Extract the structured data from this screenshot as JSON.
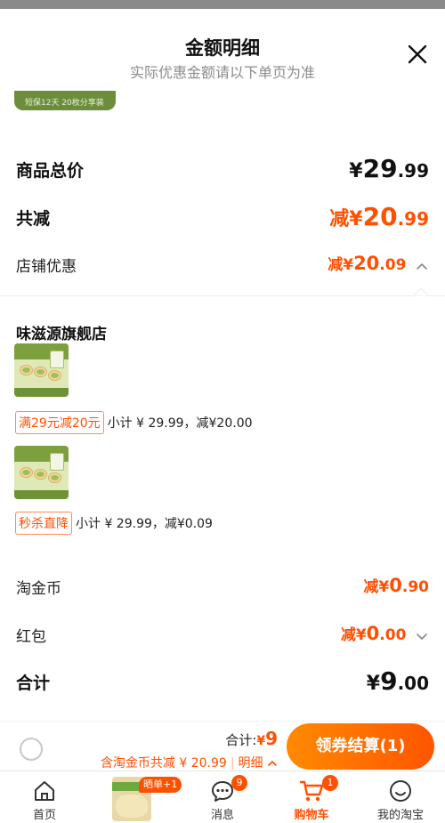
{
  "header": {
    "title": "金额明细",
    "subtitle": "实际优惠金额请以下单页为准"
  },
  "banner_text": "短保12天 20枚分享装",
  "summary": {
    "total_label": "商品总价",
    "total_currency": "¥",
    "total_int": "29",
    "total_dec": ".99",
    "reduce_label": "共减",
    "reduce_prefix": "减¥",
    "reduce_int": "20",
    "reduce_dec": ".99",
    "shop_discount_label": "店铺优惠",
    "shop_discount_prefix": "减¥",
    "shop_discount_int": "20",
    "shop_discount_dec": ".09"
  },
  "store": {
    "name": "味滋源旗舰店",
    "items": [
      {
        "tag": "满29元减20元",
        "detail": "小计 ¥ 29.99，减¥20.00"
      },
      {
        "tag": "秒杀直降",
        "detail": "小计 ¥ 29.99，减¥0.09"
      }
    ]
  },
  "extras": {
    "coin_label": "淘金币",
    "coin_prefix": "减¥",
    "coin_int": "0",
    "coin_dec": ".90",
    "redpacket_label": "红包",
    "redpacket_prefix": "减¥",
    "redpacket_int": "0",
    "redpacket_dec": ".00",
    "sum_label": "合计",
    "sum_currency": "¥",
    "sum_int": "9",
    "sum_dec": ".00"
  },
  "footer": {
    "total_label": "合计:",
    "total_currency": "¥",
    "total_amount": "9",
    "detail_text": "含淘金币共减 ¥ 20.99",
    "detail_link": "明细",
    "checkout_label": "领券结算(1)"
  },
  "tabbar": {
    "tabs": [
      {
        "label": "首页",
        "icon": "taobao-home-icon"
      },
      {
        "label": "",
        "icon": "promo-product-image",
        "tag": "晒单+1"
      },
      {
        "label": "消息",
        "icon": "message-bubble-icon",
        "badge": "9"
      },
      {
        "label": "购物车",
        "icon": "cart-icon",
        "badge": "1"
      },
      {
        "label": "我的淘宝",
        "icon": "profile-smile-icon"
      }
    ]
  },
  "colors": {
    "accent": "#ff5000",
    "checkout_gradient_start": "#ff8a00",
    "checkout_gradient_end": "#ff5500"
  }
}
